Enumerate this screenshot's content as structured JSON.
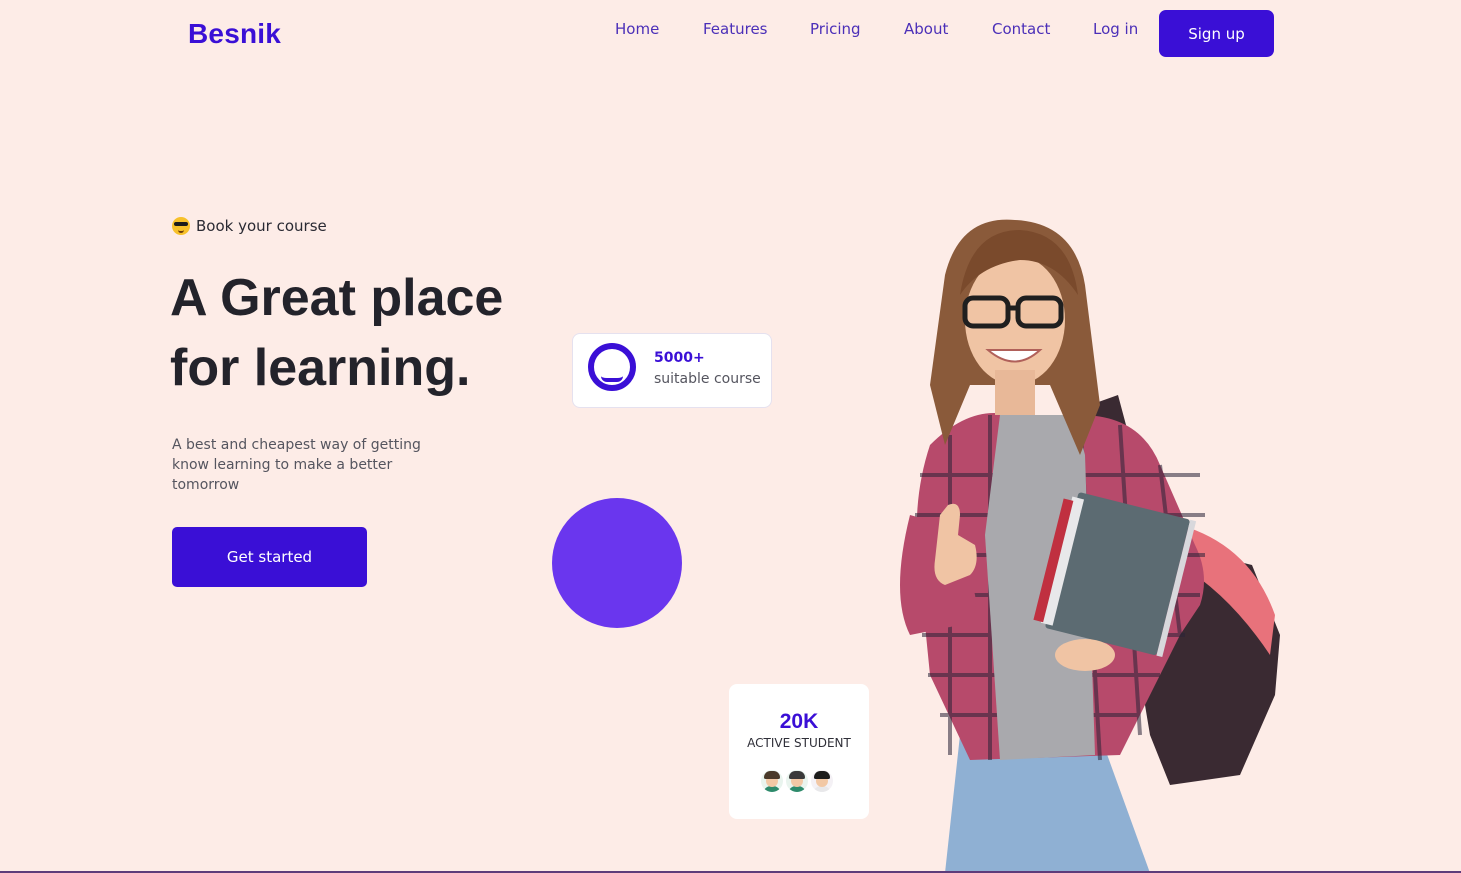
{
  "brand": {
    "name": "Besnik",
    "accent": "#3a0fd6",
    "accent_light": "#6a36ee",
    "background": "#fdece7"
  },
  "nav": {
    "items": [
      "Home",
      "Features",
      "Pricing",
      "About",
      "Contact"
    ],
    "login": "Log in",
    "signup": "Sign up"
  },
  "hero": {
    "eyebrow_icon": "sunglasses-emoji-icon",
    "eyebrow": "Book your course",
    "headline_line1": "A Great place",
    "headline_line2": "for learning.",
    "subtext": "A best and cheapest way of getting know learning to make a better tomorrow",
    "cta": "Get started"
  },
  "stats": {
    "courses": {
      "value": "5000+",
      "label": "suitable course",
      "icon": "ring-icon"
    },
    "students": {
      "value": "20K",
      "label": "ACTIVE STUDENT",
      "avatars": [
        "student-avatar-icon",
        "student-avatar-icon",
        "student-avatar-icon"
      ]
    }
  }
}
